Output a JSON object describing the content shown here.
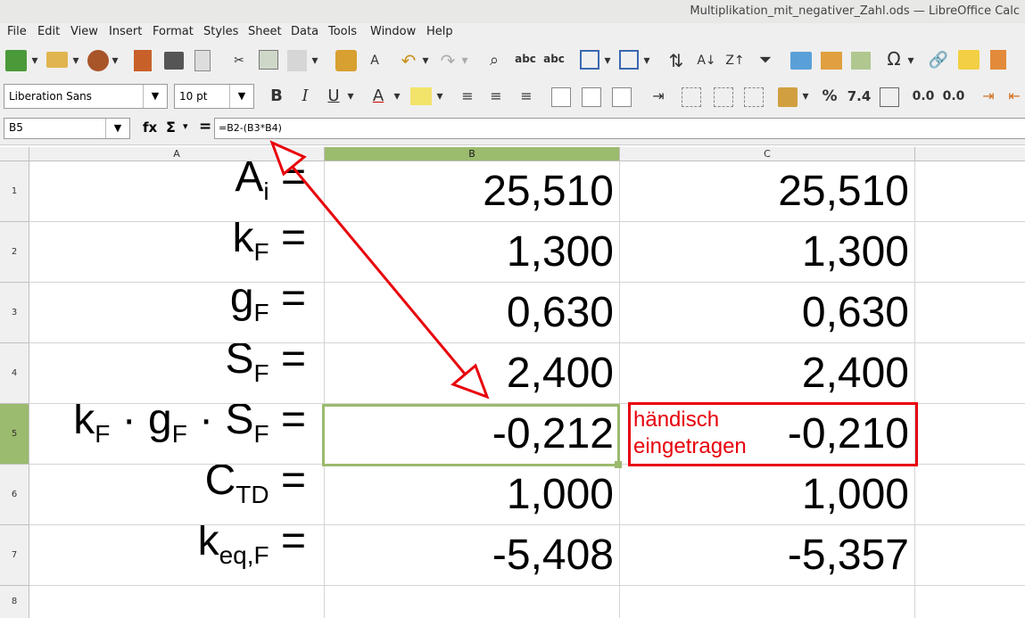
{
  "window": {
    "title": "Multiplikation_mit_negativer_Zahl.ods — LibreOffice Calc"
  },
  "menu": [
    "File",
    "Edit",
    "View",
    "Insert",
    "Format",
    "Styles",
    "Sheet",
    "Data",
    "Tools",
    "Window",
    "Help"
  ],
  "toolbar2": {
    "font_name": "Liberation Sans",
    "font_size": "10 pt",
    "bold": "B",
    "italic": "I",
    "underline": "U",
    "font_color": "A",
    "percent": "%",
    "number": "7.4",
    "add_decimal": "0.0",
    "del_decimal": "0.0"
  },
  "toolbar1": {
    "spelling": "abc",
    "autospell": "abc",
    "special_char": "Ω"
  },
  "formula_bar": {
    "cell_ref": "B5",
    "fx": "fx",
    "sigma": "Σ",
    "equals": "=",
    "formula": "=B2-(B3*B4)"
  },
  "columns": [
    "A",
    "B",
    "C"
  ],
  "rows": [
    {
      "num": "1",
      "label": {
        "main": "A",
        "sub": "i",
        "tail": " ="
      },
      "b": "25,510",
      "c": "25,510"
    },
    {
      "num": "2",
      "label": {
        "main": "k",
        "sub": "F",
        "tail": " ="
      },
      "b": "1,300",
      "c": "1,300"
    },
    {
      "num": "3",
      "label": {
        "main": "g",
        "sub": "F",
        "tail": " ="
      },
      "b": "0,630",
      "c": "0,630"
    },
    {
      "num": "4",
      "label": {
        "main": "S",
        "sub": "F",
        "tail": " ="
      },
      "b": "2,400",
      "c": "2,400"
    },
    {
      "num": "5",
      "label": {
        "p1": "k",
        "s1": "F",
        "p2": " · g",
        "s2": "F",
        "p3": " · S",
        "s3": "F",
        "tail": "  ="
      },
      "b": "-0,212",
      "c": "-0,210"
    },
    {
      "num": "6",
      "label": {
        "main": "C",
        "sub": "TD",
        "tail": " ="
      },
      "b": "1,000",
      "c": "1,000"
    },
    {
      "num": "7",
      "label": {
        "main": "k",
        "sub": "eq,F",
        "tail": " ="
      },
      "b": "-5,408",
      "c": "-5,357"
    },
    {
      "num": "8"
    }
  ],
  "annotation": {
    "line1": "händisch",
    "line2": "eingetragen",
    "color": "#e8000b"
  },
  "colors": {
    "selection": "#9bbb6e",
    "annotation_red": "#e8000b"
  }
}
